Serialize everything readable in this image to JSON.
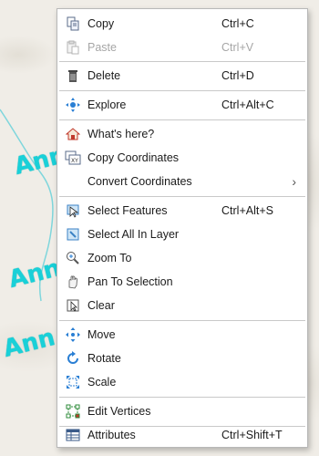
{
  "map": {
    "labels": [
      "Ann",
      "Ann",
      "Ann"
    ]
  },
  "menu": {
    "items": [
      {
        "label": "Copy",
        "shortcut": "Ctrl+C",
        "icon": "copy-icon",
        "enabled": true
      },
      {
        "label": "Paste",
        "shortcut": "Ctrl+V",
        "icon": "paste-icon",
        "enabled": false
      },
      {
        "label": "Delete",
        "shortcut": "Ctrl+D",
        "icon": "delete-icon",
        "enabled": true
      },
      {
        "label": "Explore",
        "shortcut": "Ctrl+Alt+C",
        "icon": "explore-icon",
        "enabled": true
      },
      {
        "label": "What's here?",
        "shortcut": "",
        "icon": "whats-here-icon",
        "enabled": true
      },
      {
        "label": "Copy Coordinates",
        "shortcut": "",
        "icon": "copy-coordinates-icon",
        "enabled": true
      },
      {
        "label": "Convert Coordinates",
        "shortcut": "",
        "icon": "",
        "enabled": true,
        "submenu": true
      },
      {
        "label": "Select Features",
        "shortcut": "Ctrl+Alt+S",
        "icon": "select-features-icon",
        "enabled": true
      },
      {
        "label": "Select All In Layer",
        "shortcut": "",
        "icon": "select-all-icon",
        "enabled": true
      },
      {
        "label": "Zoom To",
        "shortcut": "",
        "icon": "zoom-to-icon",
        "enabled": true
      },
      {
        "label": "Pan To Selection",
        "shortcut": "",
        "icon": "pan-icon",
        "enabled": true
      },
      {
        "label": "Clear",
        "shortcut": "",
        "icon": "clear-selection-icon",
        "enabled": true
      },
      {
        "label": "Move",
        "shortcut": "",
        "icon": "move-icon",
        "enabled": true
      },
      {
        "label": "Rotate",
        "shortcut": "",
        "icon": "rotate-icon",
        "enabled": true
      },
      {
        "label": "Scale",
        "shortcut": "",
        "icon": "scale-icon",
        "enabled": true
      },
      {
        "label": "Edit Vertices",
        "shortcut": "",
        "icon": "edit-vertices-icon",
        "enabled": true
      },
      {
        "label": "Attributes",
        "shortcut": "Ctrl+Shift+T",
        "icon": "attributes-icon",
        "enabled": true
      }
    ],
    "submenu_arrow": "›"
  }
}
